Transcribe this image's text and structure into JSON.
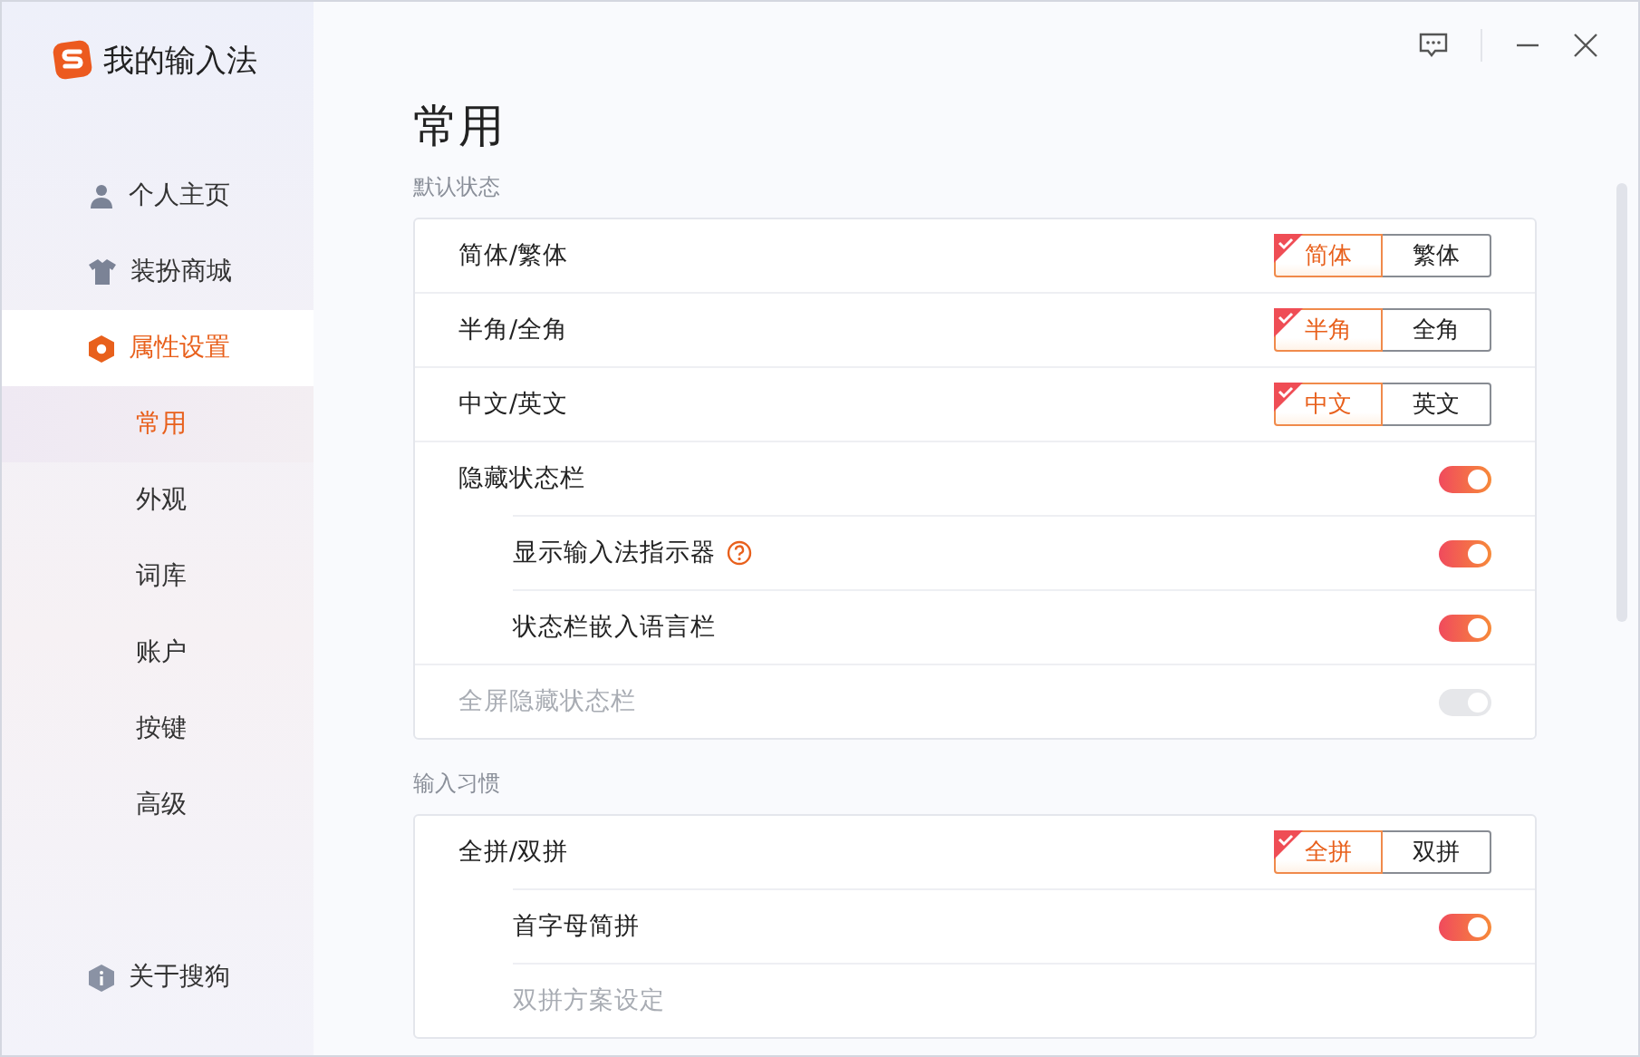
{
  "app": {
    "title": "我的输入法"
  },
  "sidebar": {
    "items": [
      {
        "label": "个人主页",
        "selected": false
      },
      {
        "label": "装扮商城",
        "selected": false
      },
      {
        "label": "属性设置",
        "selected": true,
        "children": [
          {
            "label": "常用",
            "selected": true
          },
          {
            "label": "外观",
            "selected": false
          },
          {
            "label": "词库",
            "selected": false
          },
          {
            "label": "账户",
            "selected": false
          },
          {
            "label": "按键",
            "selected": false
          },
          {
            "label": "高级",
            "selected": false
          }
        ]
      }
    ],
    "footer": {
      "label": "关于搜狗"
    }
  },
  "page": {
    "title": "常用",
    "sections": [
      {
        "label": "默认状态",
        "rows": [
          {
            "kind": "segmented",
            "label": "简体/繁体",
            "options": [
              {
                "label": "简体",
                "selected": true
              },
              {
                "label": "繁体",
                "selected": false
              }
            ]
          },
          {
            "kind": "segmented",
            "label": "半角/全角",
            "options": [
              {
                "label": "半角",
                "selected": true
              },
              {
                "label": "全角",
                "selected": false
              }
            ]
          },
          {
            "kind": "segmented",
            "label": "中文/英文",
            "options": [
              {
                "label": "中文",
                "selected": true
              },
              {
                "label": "英文",
                "selected": false
              }
            ]
          },
          {
            "kind": "toggle",
            "label": "隐藏状态栏",
            "on": true,
            "disabled": false,
            "children": [
              {
                "kind": "toggle",
                "label": "显示输入法指示器",
                "help": true,
                "on": true,
                "disabled": false
              },
              {
                "kind": "toggle",
                "label": "状态栏嵌入语言栏",
                "on": true,
                "disabled": false
              }
            ]
          },
          {
            "kind": "toggle",
            "label": "全屏隐藏状态栏",
            "on": true,
            "disabled": true
          }
        ]
      },
      {
        "label": "输入习惯",
        "rows": [
          {
            "kind": "segmented",
            "label": "全拼/双拼",
            "options": [
              {
                "label": "全拼",
                "selected": true
              },
              {
                "label": "双拼",
                "selected": false
              }
            ],
            "children": [
              {
                "kind": "toggle",
                "label": "首字母简拼",
                "on": true,
                "disabled": false
              },
              {
                "kind": "plain",
                "label": "双拼方案设定",
                "disabled": true
              }
            ]
          }
        ]
      }
    ]
  }
}
